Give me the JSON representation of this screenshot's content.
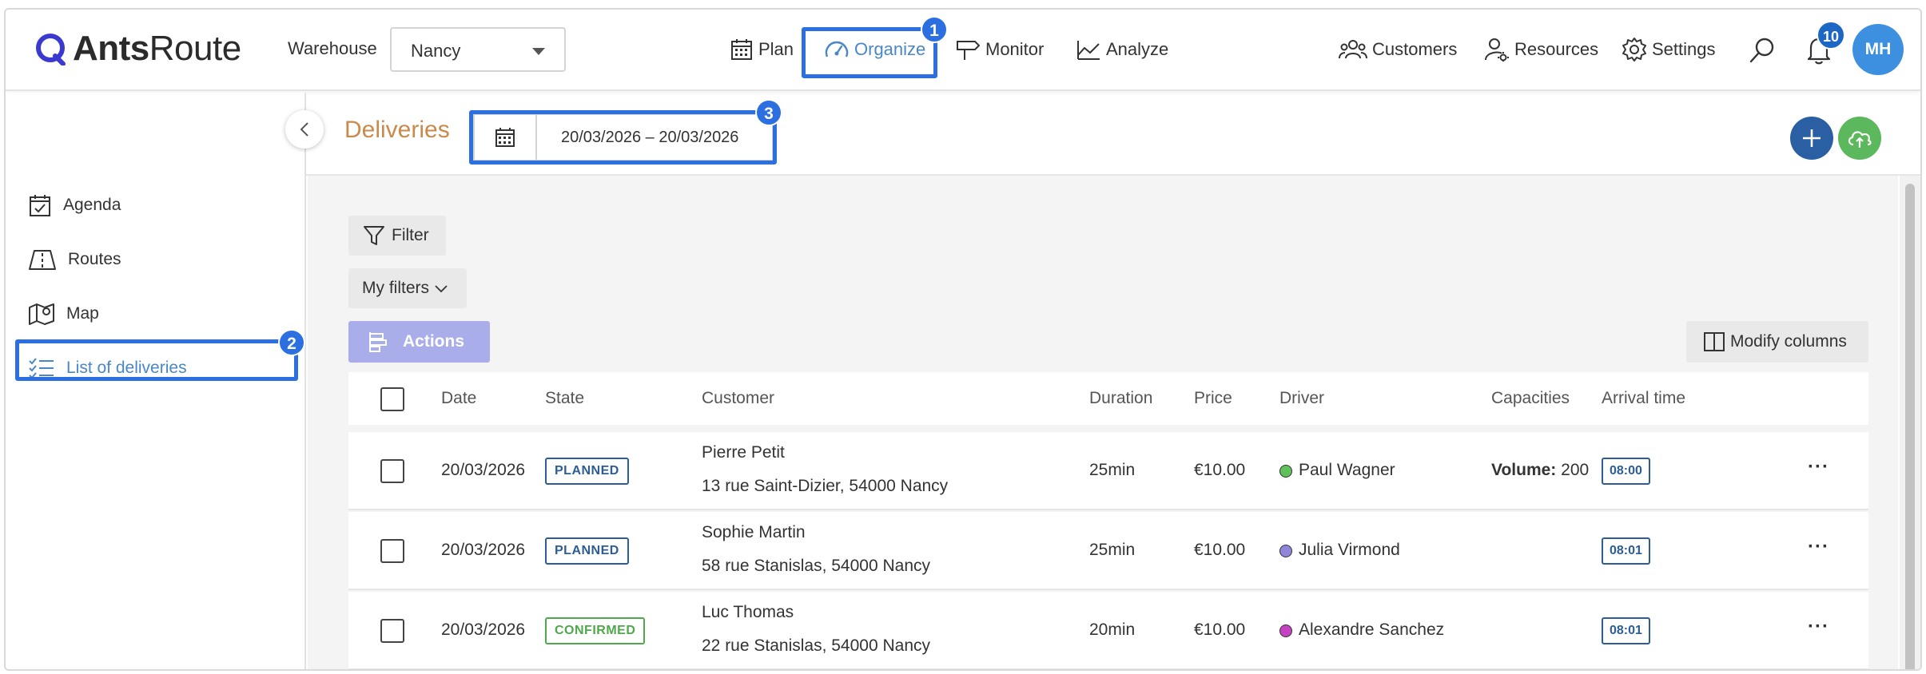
{
  "app": {
    "logo_strong": "Ants",
    "logo_light": "Route",
    "warehouse_label": "Warehouse",
    "warehouse_value": "Nancy"
  },
  "nav": {
    "plan": "Plan",
    "organize": "Organize",
    "monitor": "Monitor",
    "analyze": "Analyze",
    "customers": "Customers",
    "resources": "Resources",
    "settings": "Settings",
    "notifications_count": "10",
    "avatar_initials": "MH"
  },
  "annotations": {
    "badge1": "1",
    "badge2": "2",
    "badge3": "3"
  },
  "sidebar": {
    "items": [
      {
        "label": "Agenda",
        "icon": "calendar-check-icon"
      },
      {
        "label": "Routes",
        "icon": "routes-icon"
      },
      {
        "label": "Map",
        "icon": "map-icon"
      },
      {
        "label": "List of deliveries",
        "icon": "list-icon",
        "active": true
      }
    ]
  },
  "header": {
    "title": "Deliveries",
    "date_range": "20/03/2026 – 20/03/2026"
  },
  "toolbar": {
    "filter": "Filter",
    "my_filters": "My filters",
    "actions": "Actions",
    "modify_columns": "Modify columns"
  },
  "table": {
    "columns": [
      "Date",
      "State",
      "Customer",
      "Duration",
      "Price",
      "Driver",
      "Capacities",
      "Arrival time"
    ],
    "rows": [
      {
        "date": "20/03/2026",
        "state": "PLANNED",
        "customer": "Pierre Petit",
        "address": "13 rue Saint-Dizier, 54000 Nancy",
        "duration": "25min",
        "price": "€10.00",
        "driver": "Paul Wagner",
        "driver_color": "#5fc15a",
        "capacity_label": "Volume:",
        "capacity_value": "200",
        "arrival": "08:00"
      },
      {
        "date": "20/03/2026",
        "state": "PLANNED",
        "customer": "Sophie Martin",
        "address": "58 rue Stanislas, 54000 Nancy",
        "duration": "25min",
        "price": "€10.00",
        "driver": "Julia Virmond",
        "driver_color": "#8f86dc",
        "capacity_label": "",
        "capacity_value": "",
        "arrival": "08:01"
      },
      {
        "date": "20/03/2026",
        "state": "CONFIRMED",
        "customer": "Luc Thomas",
        "address": "22 rue Stanislas, 54000 Nancy",
        "duration": "20min",
        "price": "€10.00",
        "driver": "Alexandre Sanchez",
        "driver_color": "#c742c2",
        "capacity_label": "",
        "capacity_value": "",
        "arrival": "08:01"
      }
    ]
  },
  "colors": {
    "accent": "#4a87c9",
    "highlight": "#2c6fe0",
    "title": "#c98a4b",
    "add_button": "#2a5fa3",
    "upload_button": "#5cb85c"
  }
}
